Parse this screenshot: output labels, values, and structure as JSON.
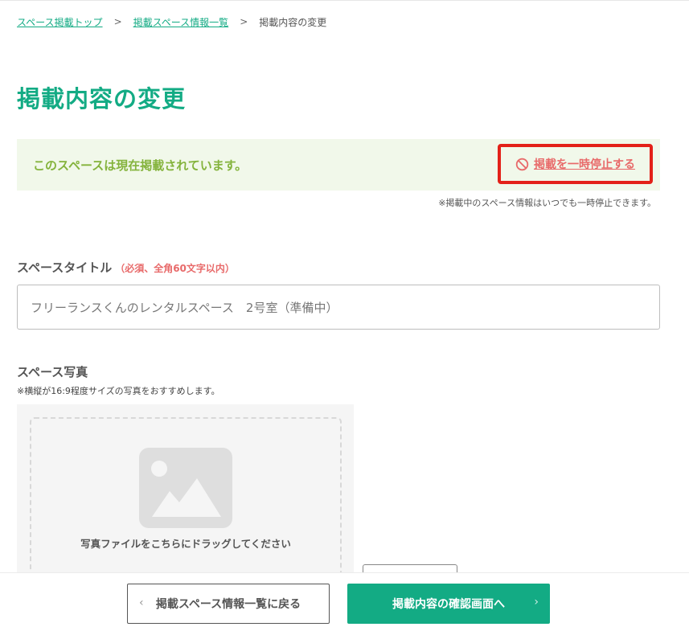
{
  "breadcrumb": {
    "items": [
      {
        "label": "スペース掲載トップ"
      },
      {
        "label": "掲載スペース情報一覧"
      }
    ],
    "separator": ">",
    "current": "掲載内容の変更"
  },
  "page": {
    "title": "掲載内容の変更"
  },
  "status": {
    "message": "このスペースは現在掲載されています。",
    "pause_label": "掲載を一時停止する",
    "note": "※掲載中のスペース情報はいつでも一時停止できます。"
  },
  "space_title": {
    "label": "スペースタイトル",
    "requirement": "（必須、全角60文字以内）",
    "value": "フリーランスくんのレンタルスペース　2号室（準備中）"
  },
  "photo": {
    "label": "スペース写真",
    "hint": "※横縦が16:9程度サイズの写真をおすすめします。",
    "drop_text": "写真ファイルをこちらにドラッグしてください"
  },
  "actions": {
    "back_label": "掲載スペース情報一覧に戻る",
    "back_chevron": "‹",
    "confirm_label": "掲載内容の確認画面へ",
    "confirm_chevron": "›"
  },
  "colors": {
    "brand": "#13ab84",
    "banner_bg": "#f1f8ea",
    "banner_text": "#84b33c",
    "alert": "#e86a6a",
    "highlight_border": "#e32119"
  },
  "icons": {
    "pause": "prohibited-icon",
    "photo": "image-placeholder-icon"
  }
}
